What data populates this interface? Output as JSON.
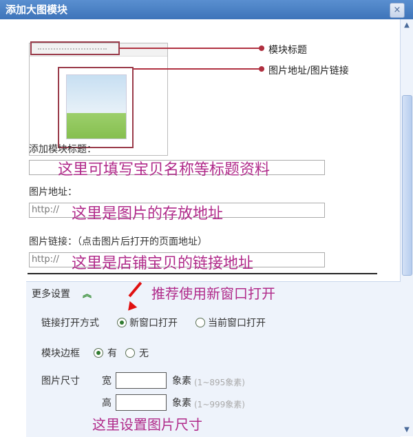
{
  "window": {
    "title": "添加大图模块",
    "close_label": "×"
  },
  "example": {
    "title_pointer": "模块标题",
    "image_pointer": "图片地址/图片链接"
  },
  "fields": {
    "title_label": "添加模块标题：",
    "title_annotation": "这里可填写宝贝名称等标题资料",
    "image_url_label": "图片地址：",
    "image_url_placeholder": "http://",
    "image_url_annotation": "这里是图片的存放地址",
    "image_link_label": "图片链接：（点击图片后打开的页面地址）",
    "image_link_placeholder": "http://",
    "image_link_annotation": "这里是店铺宝贝的链接地址"
  },
  "settings": {
    "more_label": "更多设置",
    "collapse_icon": "«",
    "new_window_tip": "推荐使用新窗口打开",
    "link_open_label": "链接打开方式",
    "link_option_new": "新窗口打开",
    "link_option_current": "当前窗口打开",
    "border_label": "模块边框",
    "border_yes": "有",
    "border_no": "无",
    "size_label": "图片尺寸",
    "width_label": "宽",
    "height_label": "高",
    "unit": "象素",
    "width_hint": "(1~895象素)",
    "height_hint": "(1~999象素)",
    "size_annotation": "这里设置图片尺寸"
  },
  "colors": {
    "annotation": "#b02a8a",
    "pointer": "#b03040",
    "titlebar": "#3e74b9"
  }
}
